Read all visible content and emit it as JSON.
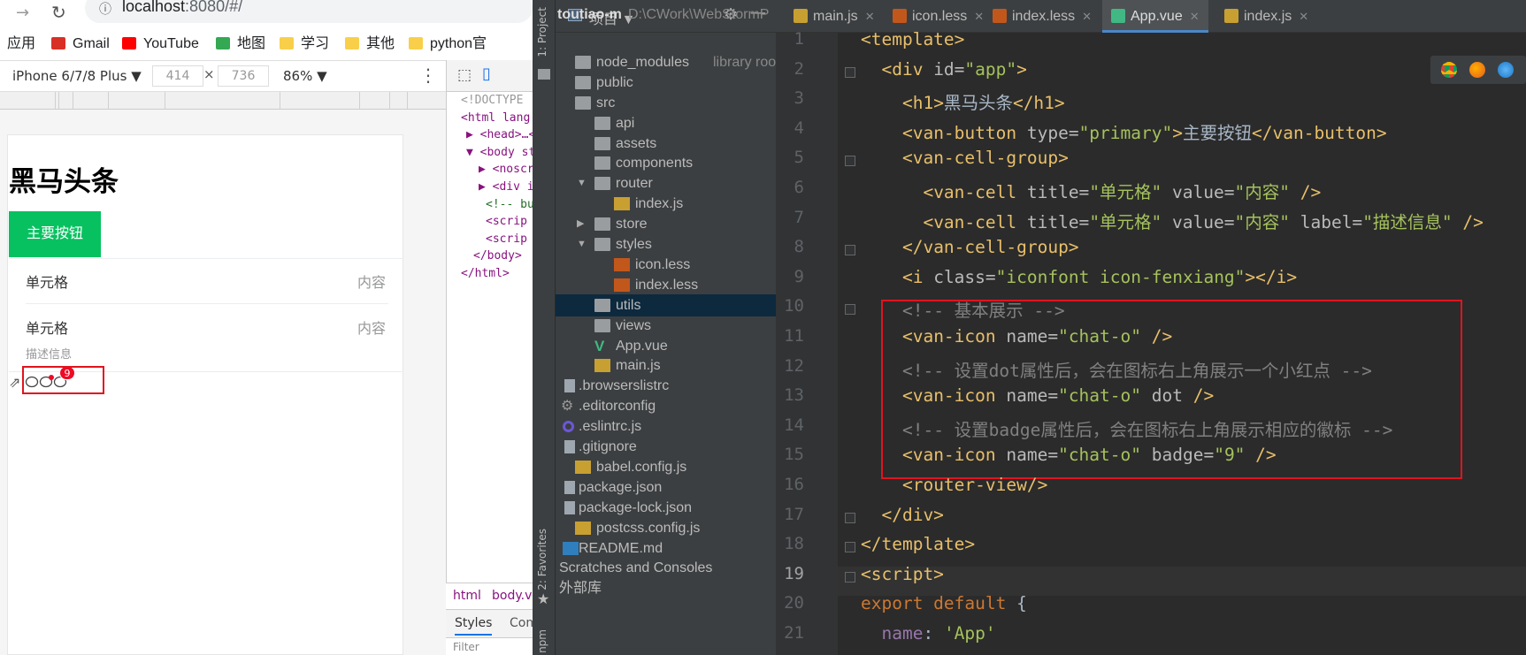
{
  "browser": {
    "url_host": "localhost",
    "url_rest": ":8080/#/",
    "bookmarks": [
      {
        "label": "应用",
        "icon": "apps-grid-icon"
      },
      {
        "label": "Gmail",
        "icon": "gmail-icon"
      },
      {
        "label": "YouTube",
        "icon": "youtube-icon"
      },
      {
        "label": "地图",
        "icon": "maps-icon"
      },
      {
        "label": "学习",
        "icon": "folder-icon"
      },
      {
        "label": "其他",
        "icon": "folder-icon"
      },
      {
        "label": "python官",
        "icon": "folder-icon"
      }
    ]
  },
  "device_toolbar": {
    "device": "iPhone 6/7/8 Plus ▼",
    "width": "414",
    "height": "736",
    "zoom": "86% ▼"
  },
  "page": {
    "h1": "黑马头条",
    "primary_button": "主要按钮",
    "cells": [
      {
        "title": "单元格",
        "value": "内容",
        "label": ""
      },
      {
        "title": "单元格",
        "value": "内容",
        "label": "描述信息"
      }
    ],
    "badge": "9"
  },
  "devtools": {
    "tree": [
      {
        "text": "<!DOCTYPE",
        "kind": "doc"
      },
      {
        "text": "<html lang",
        "kind": "tag"
      },
      {
        "text": "▶ <head>…<",
        "kind": "tag"
      },
      {
        "text": "▼ <body st",
        "kind": "tag"
      },
      {
        "text": "▶ <noscri",
        "kind": "tag"
      },
      {
        "text": "▶ <div i",
        "kind": "tag"
      },
      {
        "text": "<!-- bu",
        "kind": "cmt"
      },
      {
        "text": "<scrip",
        "kind": "tag"
      },
      {
        "text": "<scrip",
        "kind": "tag"
      },
      {
        "text": "</body>",
        "kind": "tag"
      },
      {
        "text": "</html>",
        "kind": "tag"
      }
    ],
    "crumbs": [
      "html",
      "body.v"
    ],
    "tabs": [
      "Styles",
      "Com"
    ],
    "filter": "Filter"
  },
  "ide": {
    "side_labels": [
      "1: Project",
      "2: Favorites",
      "npm"
    ],
    "project_header": "项目 ▼",
    "tree": [
      {
        "label": "toutiao-m",
        "extra": "D:\\CWork\\WebStormP",
        "icon": "none",
        "indent": 0,
        "arrow": ""
      },
      {
        "label": "node_modules",
        "extra": "library root",
        "icon": "folder",
        "indent": 0,
        "arrow": ""
      },
      {
        "label": "public",
        "extra": "",
        "icon": "folder",
        "indent": 0,
        "arrow": ""
      },
      {
        "label": "src",
        "extra": "",
        "icon": "folder",
        "indent": 0,
        "arrow": ""
      },
      {
        "label": "api",
        "extra": "",
        "icon": "folder",
        "indent": 1,
        "arrow": ""
      },
      {
        "label": "assets",
        "extra": "",
        "icon": "folder",
        "indent": 1,
        "arrow": ""
      },
      {
        "label": "components",
        "extra": "",
        "icon": "folder",
        "indent": 1,
        "arrow": ""
      },
      {
        "label": "router",
        "extra": "",
        "icon": "folder",
        "indent": 1,
        "arrow": "▼"
      },
      {
        "label": "index.js",
        "extra": "",
        "icon": "js",
        "indent": 2,
        "arrow": ""
      },
      {
        "label": "store",
        "extra": "",
        "icon": "folder",
        "indent": 1,
        "arrow": "▶"
      },
      {
        "label": "styles",
        "extra": "",
        "icon": "folder",
        "indent": 1,
        "arrow": "▼"
      },
      {
        "label": "icon.less",
        "extra": "",
        "icon": "less",
        "indent": 2,
        "arrow": ""
      },
      {
        "label": "index.less",
        "extra": "",
        "icon": "less",
        "indent": 2,
        "arrow": ""
      },
      {
        "label": "utils",
        "extra": "",
        "icon": "folder",
        "indent": 1,
        "arrow": ""
      },
      {
        "label": "views",
        "extra": "",
        "icon": "folder",
        "indent": 1,
        "arrow": ""
      },
      {
        "label": "App.vue",
        "extra": "",
        "icon": "vue",
        "indent": 1,
        "arrow": ""
      },
      {
        "label": "main.js",
        "extra": "",
        "icon": "js",
        "indent": 1,
        "arrow": ""
      },
      {
        "label": ".browserslistrc",
        "extra": "",
        "icon": "file",
        "indent": 0,
        "arrow": ""
      },
      {
        "label": ".editorconfig",
        "extra": "",
        "icon": "gear",
        "indent": 0,
        "arrow": ""
      },
      {
        "label": ".eslintrc.js",
        "extra": "",
        "icon": "ring",
        "indent": 0,
        "arrow": ""
      },
      {
        "label": ".gitignore",
        "extra": "",
        "icon": "file",
        "indent": 0,
        "arrow": ""
      },
      {
        "label": "babel.config.js",
        "extra": "",
        "icon": "js",
        "indent": 0,
        "arrow": ""
      },
      {
        "label": "package.json",
        "extra": "",
        "icon": "file",
        "indent": 0,
        "arrow": ""
      },
      {
        "label": "package-lock.json",
        "extra": "",
        "icon": "file",
        "indent": 0,
        "arrow": ""
      },
      {
        "label": "postcss.config.js",
        "extra": "",
        "icon": "js",
        "indent": 0,
        "arrow": ""
      },
      {
        "label": "README.md",
        "extra": "",
        "icon": "md",
        "indent": 0,
        "arrow": ""
      },
      {
        "label": "Scratches and Consoles",
        "extra": "",
        "icon": "none",
        "indent": 0,
        "arrow": ""
      },
      {
        "label": "外部库",
        "extra": "",
        "icon": "none",
        "indent": 0,
        "arrow": ""
      }
    ],
    "tabs": [
      {
        "label": "main.js",
        "icon": "js",
        "active": false
      },
      {
        "label": "icon.less",
        "icon": "less",
        "active": false
      },
      {
        "label": "index.less",
        "icon": "less",
        "active": false
      },
      {
        "label": "App.vue",
        "icon": "vue",
        "active": true
      },
      {
        "label": "index.js",
        "icon": "js",
        "active": false
      }
    ],
    "code_lines": [
      [
        [
          "t",
          "<template>"
        ]
      ],
      [
        [
          "p",
          "  "
        ],
        [
          "t",
          "<div "
        ],
        [
          "a",
          "id="
        ],
        [
          "s",
          "\"app\""
        ],
        [
          "t",
          ">"
        ]
      ],
      [
        [
          "p",
          "    "
        ],
        [
          "t",
          "<h1>"
        ],
        [
          "p",
          "黑马头条"
        ],
        [
          "t",
          "</h1>"
        ]
      ],
      [
        [
          "p",
          "    "
        ],
        [
          "t",
          "<van-button "
        ],
        [
          "a",
          "type="
        ],
        [
          "s",
          "\"primary\""
        ],
        [
          "t",
          ">"
        ],
        [
          "p",
          "主要按钮"
        ],
        [
          "t",
          "</van-button>"
        ]
      ],
      [
        [
          "p",
          "    "
        ],
        [
          "t",
          "<van-cell-group>"
        ]
      ],
      [
        [
          "p",
          "      "
        ],
        [
          "t",
          "<van-cell "
        ],
        [
          "a",
          "title="
        ],
        [
          "s",
          "\"单元格\" "
        ],
        [
          "a",
          "value="
        ],
        [
          "s",
          "\"内容\" "
        ],
        [
          "t",
          "/>"
        ]
      ],
      [
        [
          "p",
          "      "
        ],
        [
          "t",
          "<van-cell "
        ],
        [
          "a",
          "title="
        ],
        [
          "s",
          "\"单元格\" "
        ],
        [
          "a",
          "value="
        ],
        [
          "s",
          "\"内容\" "
        ],
        [
          "a",
          "label="
        ],
        [
          "s",
          "\"描述信息\" "
        ],
        [
          "t",
          "/>"
        ]
      ],
      [
        [
          "p",
          "    "
        ],
        [
          "t",
          "</van-cell-group>"
        ]
      ],
      [
        [
          "p",
          "    "
        ],
        [
          "t",
          "<i "
        ],
        [
          "a",
          "class="
        ],
        [
          "s",
          "\"iconfont icon-fenxiang\""
        ],
        [
          "t",
          "></i>"
        ]
      ],
      [
        [
          "p",
          "    "
        ],
        [
          "c",
          "<!-- 基本展示 -->"
        ]
      ],
      [
        [
          "p",
          "    "
        ],
        [
          "t",
          "<van-icon "
        ],
        [
          "a",
          "name="
        ],
        [
          "s",
          "\"chat-o\" "
        ],
        [
          "t",
          "/>"
        ]
      ],
      [
        [
          "p",
          "    "
        ],
        [
          "c",
          "<!-- 设置dot属性后，会在图标右上角展示一个小红点 -->"
        ]
      ],
      [
        [
          "p",
          "    "
        ],
        [
          "t",
          "<van-icon "
        ],
        [
          "a",
          "name="
        ],
        [
          "s",
          "\"chat-o\" "
        ],
        [
          "a",
          "dot "
        ],
        [
          "t",
          "/>"
        ]
      ],
      [
        [
          "p",
          "    "
        ],
        [
          "c",
          "<!-- 设置badge属性后，会在图标右上角展示相应的徽标 -->"
        ]
      ],
      [
        [
          "p",
          "    "
        ],
        [
          "t",
          "<van-icon "
        ],
        [
          "a",
          "name="
        ],
        [
          "s",
          "\"chat-o\" "
        ],
        [
          "a",
          "badge="
        ],
        [
          "s",
          "\"9\" "
        ],
        [
          "t",
          "/>"
        ]
      ],
      [
        [
          "p",
          "    "
        ],
        [
          "t",
          "<router-view/>"
        ]
      ],
      [
        [
          "p",
          "  "
        ],
        [
          "t",
          "</div>"
        ]
      ],
      [
        [
          "t",
          "</template>"
        ]
      ],
      [
        [
          "t",
          "<script>"
        ]
      ],
      [
        [
          "k",
          "export default "
        ],
        [
          "p",
          "{"
        ]
      ],
      [
        [
          "p",
          "  "
        ],
        [
          "n",
          "name"
        ],
        [
          "p",
          ": "
        ],
        [
          "s",
          "'App'"
        ]
      ]
    ]
  },
  "colors": {
    "primary_green": "#07c160",
    "annotation_red": "#e0141e",
    "ide_bg": "#2b2b2b"
  }
}
